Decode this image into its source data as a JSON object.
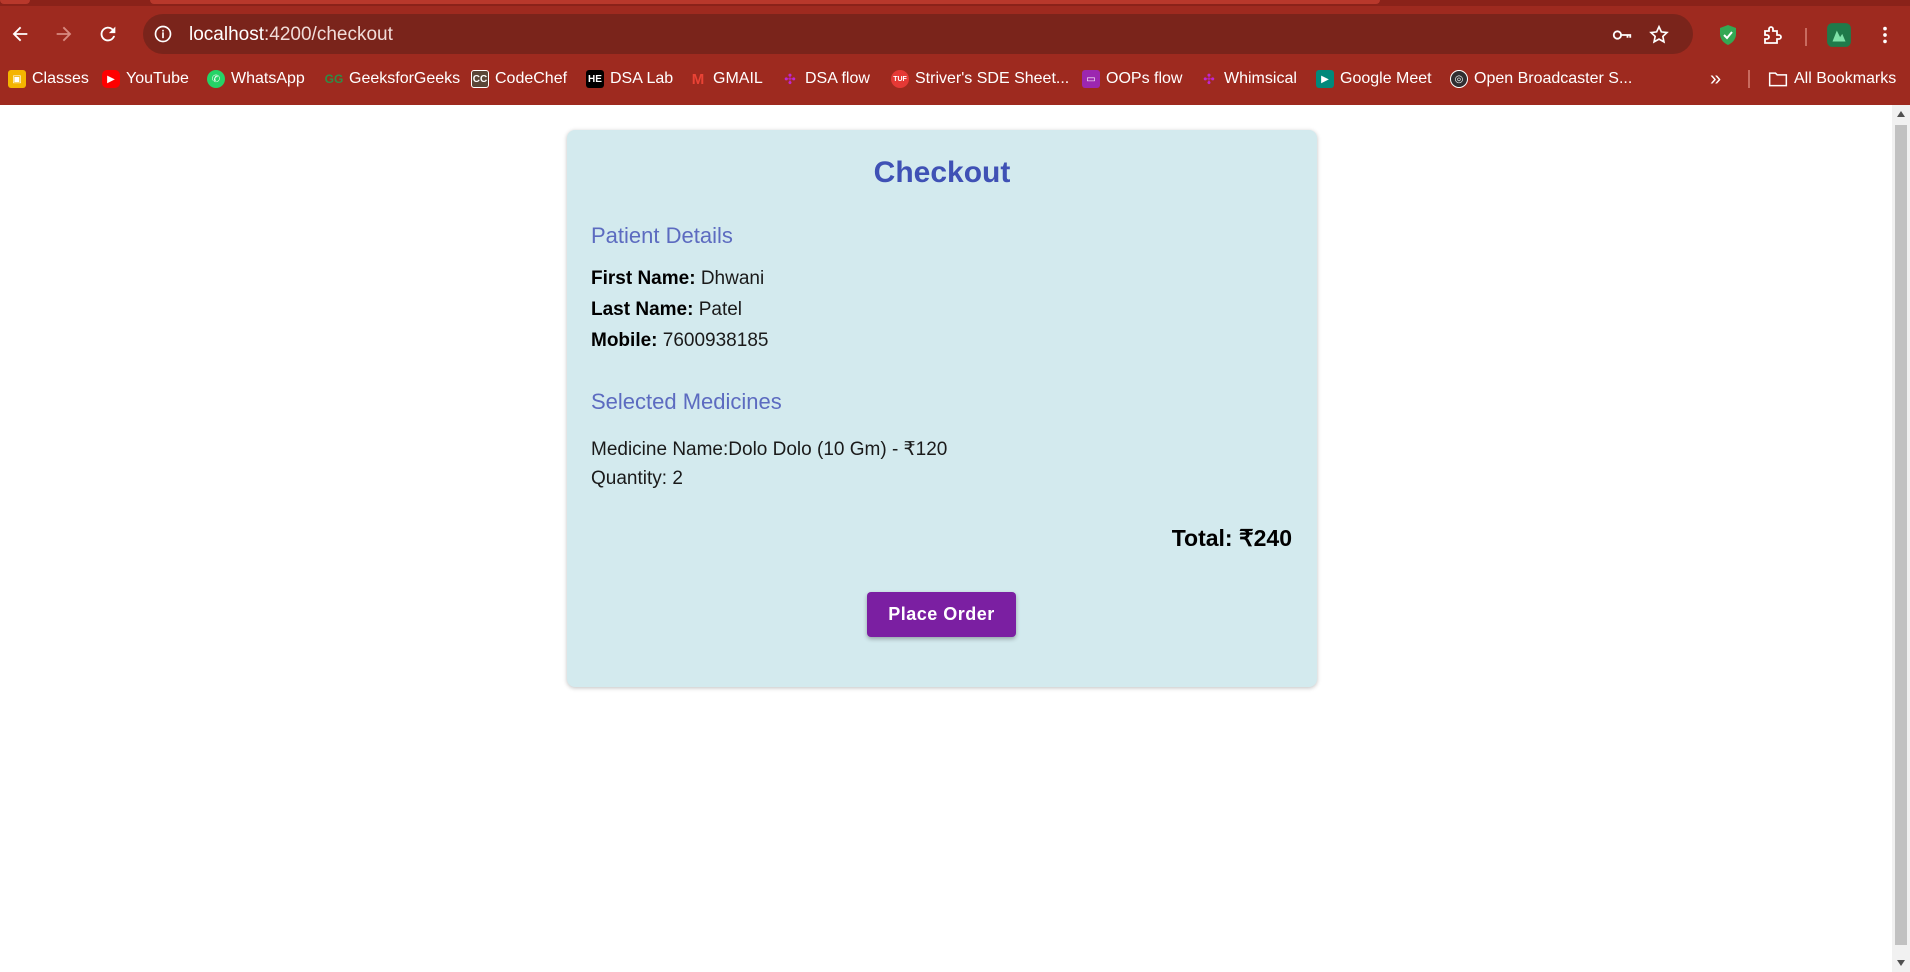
{
  "browser": {
    "url_host": "localhost",
    "url_rest": ":4200/checkout",
    "bookmarks": [
      {
        "label": "Classes",
        "icon": "classroom-icon",
        "color": "#f4b400"
      },
      {
        "label": "YouTube",
        "icon": "youtube-icon",
        "color": "#ff0000"
      },
      {
        "label": "WhatsApp",
        "icon": "whatsapp-icon",
        "color": "#25d366"
      },
      {
        "label": "GeeksforGeeks",
        "icon": "gfg-icon",
        "color": "#2f8d46"
      },
      {
        "label": "CodeChef",
        "icon": "codechef-icon",
        "color": "#5b4638"
      },
      {
        "label": "DSA Lab",
        "icon": "hackerearth-icon",
        "color": "#000000"
      },
      {
        "label": "GMAIL",
        "icon": "gmail-icon",
        "color": "#ea4335"
      },
      {
        "label": "DSA flow",
        "icon": "whimsical-icon",
        "color": "#c026d3"
      },
      {
        "label": "Striver's SDE Sheet...",
        "icon": "tuf-icon",
        "color": "#e53935"
      },
      {
        "label": "OOPs flow",
        "icon": "whimsical-icon",
        "color": "#9c27b0"
      },
      {
        "label": "Whimsical",
        "icon": "whimsical-icon",
        "color": "#c026d3"
      },
      {
        "label": "Google Meet",
        "icon": "meet-icon",
        "color": "#00897b"
      },
      {
        "label": "Open Broadcaster S...",
        "icon": "obs-icon",
        "color": "#302e31"
      }
    ],
    "overflow_label": "»",
    "all_bookmarks": "All Bookmarks"
  },
  "checkout": {
    "title": "Checkout",
    "patient_section": "Patient Details",
    "first_name_label": "First Name:",
    "first_name": "Dhwani",
    "last_name_label": "Last Name:",
    "last_name": "Patel",
    "mobile_label": "Mobile:",
    "mobile": "7600938185",
    "medicines_section": "Selected Medicines",
    "medicine_line": "Medicine Name:Dolo Dolo (10 Gm) - ₹120",
    "quantity_line": "Quantity: 2",
    "total": "Total: ₹240",
    "place_order": "Place Order"
  },
  "colors": {
    "chrome": "#9e2a1f",
    "card": "#d3eaee",
    "title": "#3f51b5",
    "section": "#5c6bc0",
    "button": "#7b1fa2"
  }
}
